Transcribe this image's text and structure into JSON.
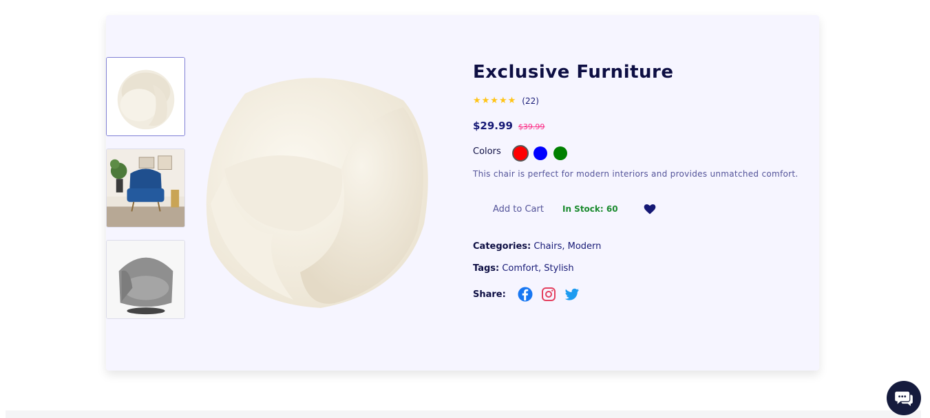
{
  "product": {
    "title": "Exclusive Furniture",
    "rating": {
      "stars": "★★★★★",
      "count_text": "(22)"
    },
    "price": "$29.99",
    "old_price": "$39.99",
    "colors_label": "Colors",
    "colors": [
      {
        "name": "red",
        "hex": "#ff0000",
        "selected": true
      },
      {
        "name": "blue",
        "hex": "#0000ff",
        "selected": false
      },
      {
        "name": "green",
        "hex": "#008000",
        "selected": false
      }
    ],
    "description": "This chair is perfect for modern interiors and provides unmatched comfort.",
    "add_to_cart_label": "Add to Cart",
    "stock_text": "In Stock: 60",
    "categories_label": "Categories:",
    "categories_value": "Chairs, Modern",
    "tags_label": "Tags:",
    "tags_value": "Comfort, Stylish",
    "share_label": "Share:"
  },
  "gallery": {
    "thumbnails": [
      {
        "name": "white-boucle-chair",
        "active": true
      },
      {
        "name": "blue-wingback-chair",
        "active": false
      },
      {
        "name": "grey-swivel-chair",
        "active": false
      }
    ]
  },
  "icons": {
    "wishlist": "heart-icon",
    "share": [
      "facebook-icon",
      "instagram-icon",
      "twitter-icon"
    ],
    "chat": "chat-icon"
  },
  "theme": {
    "primary": "#151875",
    "accent_pink": "#fb2e86",
    "star": "#ffc416",
    "stock_green": "#1a8a2e",
    "card_bg": "#f6f5ff",
    "facebook_blue": "#1877f2",
    "instagram_pink": "#e4405f",
    "twitter_blue": "#1d9bf0"
  }
}
